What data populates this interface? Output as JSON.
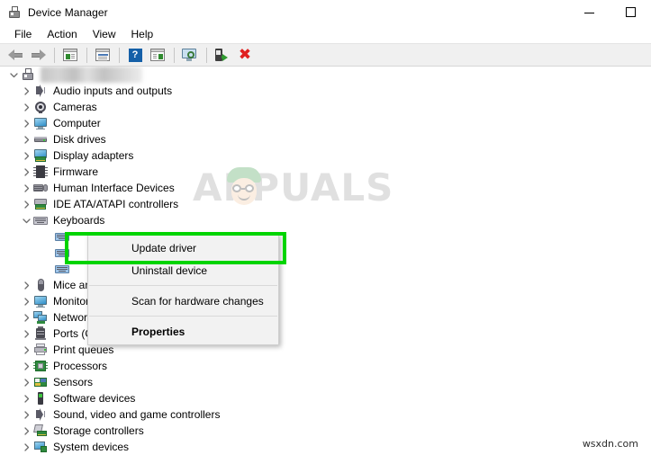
{
  "window": {
    "title": "Device Manager",
    "icon": "device-manager-icon",
    "controls": {
      "minimize": "—",
      "maximize": "□"
    }
  },
  "menubar": {
    "items": [
      {
        "label": "File"
      },
      {
        "label": "Action"
      },
      {
        "label": "View"
      },
      {
        "label": "Help"
      }
    ]
  },
  "toolbar": {
    "buttons": [
      {
        "name": "back-button",
        "icon": "arrow-left-icon",
        "label": "Back"
      },
      {
        "name": "forward-button",
        "icon": "arrow-right-icon",
        "label": "Forward"
      },
      {
        "name": "show-hide-console-tree-button",
        "icon": "console-tree-icon",
        "label": "Show/Hide Console Tree"
      },
      {
        "name": "properties-button",
        "icon": "properties-icon",
        "label": "Properties"
      },
      {
        "name": "help-button",
        "icon": "help-icon",
        "label": "Help"
      },
      {
        "name": "update-driver-button",
        "icon": "update-driver-icon",
        "label": "Update Driver Software"
      },
      {
        "name": "scan-devices-button",
        "icon": "monitor-scan-icon",
        "label": "Scan for hardware changes"
      },
      {
        "name": "add-legacy-hardware-button",
        "icon": "add-hardware-icon",
        "label": "Add legacy hardware"
      },
      {
        "name": "uninstall-device-button",
        "icon": "red-x-icon",
        "label": "Uninstall device"
      }
    ]
  },
  "tree": {
    "root": {
      "label": "DESKTOP-XXXXXX",
      "blurred": true,
      "icon": "computer-icon",
      "expanded": true
    },
    "items": [
      {
        "label": "Audio inputs and outputs",
        "icon": "speaker-icon",
        "expanded": false,
        "indent": 1
      },
      {
        "label": "Cameras",
        "icon": "camera-icon",
        "expanded": false,
        "indent": 1
      },
      {
        "label": "Computer",
        "icon": "monitor-icon",
        "expanded": false,
        "indent": 1
      },
      {
        "label": "Disk drives",
        "icon": "disk-drive-icon",
        "expanded": false,
        "indent": 1
      },
      {
        "label": "Display adapters",
        "icon": "display-adapter-icon",
        "expanded": false,
        "indent": 1
      },
      {
        "label": "Firmware",
        "icon": "chip-icon",
        "expanded": false,
        "indent": 1
      },
      {
        "label": "Human Interface Devices",
        "icon": "hid-icon",
        "expanded": false,
        "indent": 1
      },
      {
        "label": "IDE ATA/ATAPI controllers",
        "icon": "ide-controller-icon",
        "expanded": false,
        "indent": 1
      },
      {
        "label": "Keyboards",
        "icon": "keyboard-icon",
        "expanded": true,
        "indent": 1
      },
      {
        "label": "",
        "icon": "keyboard-device-icon",
        "expanded": null,
        "indent": 2,
        "child": true
      },
      {
        "label": "",
        "icon": "keyboard-device-icon",
        "expanded": null,
        "indent": 2,
        "child": true
      },
      {
        "label": "",
        "icon": "keyboard-device-icon",
        "expanded": null,
        "indent": 2,
        "child": true
      },
      {
        "label": "Mice and other pointing devices",
        "icon": "mouse-icon",
        "expanded": false,
        "indent": 1
      },
      {
        "label": "Monitors",
        "icon": "monitor-icon",
        "expanded": false,
        "indent": 1
      },
      {
        "label": "Network adapters",
        "icon": "network-icon",
        "expanded": false,
        "indent": 1
      },
      {
        "label": "Ports (COM & LPT)",
        "icon": "port-icon",
        "expanded": false,
        "indent": 1
      },
      {
        "label": "Print queues",
        "icon": "printer-icon",
        "expanded": false,
        "indent": 1
      },
      {
        "label": "Processors",
        "icon": "processor-icon",
        "expanded": false,
        "indent": 1
      },
      {
        "label": "Sensors",
        "icon": "sensor-icon",
        "expanded": false,
        "indent": 1
      },
      {
        "label": "Software devices",
        "icon": "software-device-icon",
        "expanded": false,
        "indent": 1
      },
      {
        "label": "Sound, video and game controllers",
        "icon": "speaker-icon",
        "expanded": false,
        "indent": 1
      },
      {
        "label": "Storage controllers",
        "icon": "storage-controller-icon",
        "expanded": false,
        "indent": 1
      },
      {
        "label": "System devices",
        "icon": "system-device-icon",
        "expanded": false,
        "indent": 1
      }
    ]
  },
  "context_menu": {
    "items": [
      {
        "label": "Update driver",
        "bold": false,
        "highlighted": true
      },
      {
        "label": "Uninstall device",
        "bold": false,
        "highlighted": false
      },
      {
        "separator": true
      },
      {
        "label": "Scan for hardware changes",
        "bold": false,
        "highlighted": false
      },
      {
        "separator": true
      },
      {
        "label": "Properties",
        "bold": true,
        "highlighted": false
      }
    ]
  },
  "annotation": {
    "highlight_color": "#00d400",
    "target_label": "Update driver"
  },
  "watermarks": {
    "center": "APPUALS",
    "corner": "wsxdn.com"
  }
}
